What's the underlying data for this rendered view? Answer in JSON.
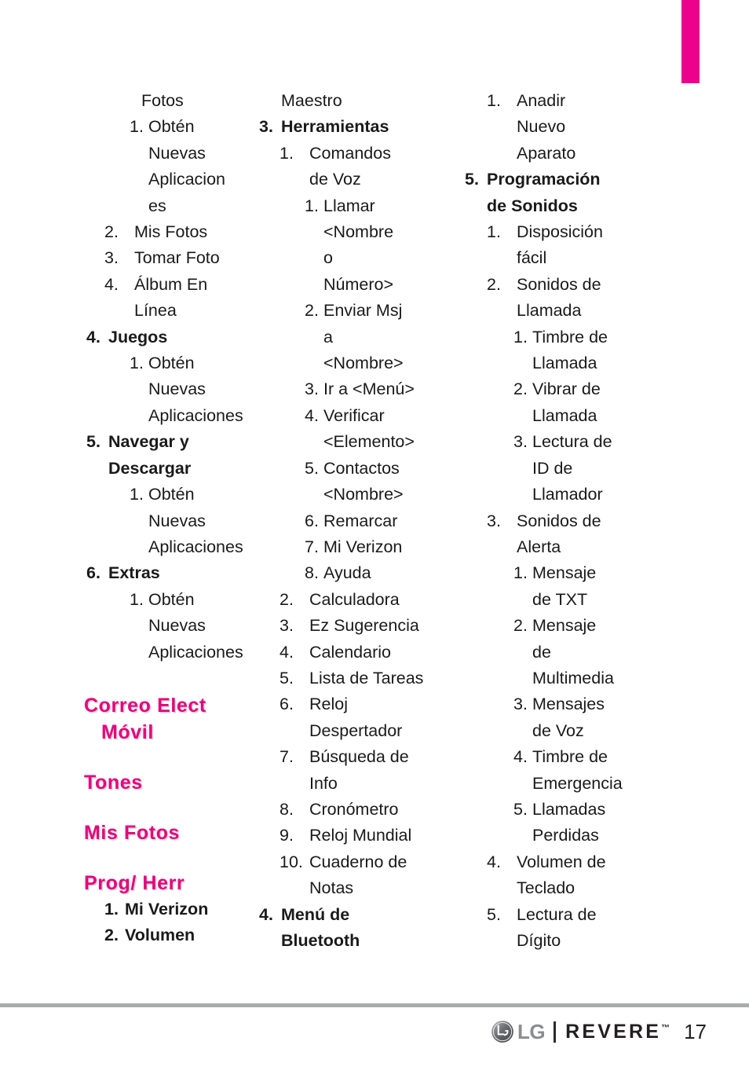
{
  "page": {
    "number": "17",
    "tab_color": "#ec008c",
    "heading_color": "#e6007e"
  },
  "footer": {
    "brand": "LG",
    "model": "REVERE",
    "trademark": "™",
    "page_number": "17"
  },
  "columns": [
    {
      "id": "column-1",
      "lines": [
        {
          "level": "plain",
          "num": "",
          "text": "Fotos"
        },
        {
          "level": "lvl3",
          "num": "1.",
          "text": "Obtén"
        },
        {
          "level": "cont-l3",
          "num": "",
          "text": "Nuevas"
        },
        {
          "level": "cont-l3",
          "num": "",
          "text": "Aplicacion"
        },
        {
          "level": "cont-l3",
          "num": "",
          "text": "es"
        },
        {
          "level": "lvl2",
          "num": "2.",
          "text": "Mis Fotos"
        },
        {
          "level": "lvl2",
          "num": "3.",
          "text": "Tomar Foto"
        },
        {
          "level": "lvl2",
          "num": "4.",
          "text": "Álbum En"
        },
        {
          "level": "cont-l2",
          "num": "",
          "text": "Línea"
        },
        {
          "level": "lvl1",
          "num": "4.",
          "text": "Juegos"
        },
        {
          "level": "lvl3",
          "num": "1.",
          "text": "Obtén"
        },
        {
          "level": "cont-l3",
          "num": "",
          "text": "Nuevas"
        },
        {
          "level": "cont-l3",
          "num": "",
          "text": "Aplicaciones"
        },
        {
          "level": "lvl1",
          "num": "5.",
          "text": "Navegar y"
        },
        {
          "level": "cont-l1",
          "num": "",
          "text": "Descargar"
        },
        {
          "level": "lvl3",
          "num": "1.",
          "text": "Obtén"
        },
        {
          "level": "cont-l3",
          "num": "",
          "text": "Nuevas"
        },
        {
          "level": "cont-l3",
          "num": "",
          "text": "Aplicaciones"
        },
        {
          "level": "lvl1",
          "num": "6.",
          "text": "Extras"
        },
        {
          "level": "lvl3",
          "num": "1.",
          "text": "Obtén"
        },
        {
          "level": "cont-l3",
          "num": "",
          "text": "Nuevas"
        },
        {
          "level": "cont-l3",
          "num": "",
          "text": "Aplicaciones"
        }
      ],
      "sections": [
        {
          "id": "correo-elect-movil",
          "title": "Correo Elect",
          "subtitle": "Móvil",
          "items": []
        },
        {
          "id": "tones",
          "title": "Tones",
          "subtitle": "",
          "items": []
        },
        {
          "id": "mis-fotos",
          "title": "Mis Fotos",
          "subtitle": "",
          "items": []
        },
        {
          "id": "prog-herr",
          "title": "Prog/ Herr",
          "subtitle": "",
          "items": [
            {
              "level": "lvl3-bold",
              "num": "1.",
              "text": "Mi Verizon"
            },
            {
              "level": "lvl3-bold",
              "num": "2.",
              "text": "Volumen"
            }
          ]
        }
      ]
    },
    {
      "id": "column-2",
      "lines": [
        {
          "level": "plain",
          "num": "",
          "text": "Maestro"
        },
        {
          "level": "lvl1",
          "num": "3.",
          "text": "Herramientas"
        },
        {
          "level": "lvl2",
          "num": "1.",
          "text": "Comandos"
        },
        {
          "level": "cont-l2",
          "num": "",
          "text": "de Voz"
        },
        {
          "level": "lvl3",
          "num": "1.",
          "text": "Llamar"
        },
        {
          "level": "cont-l3",
          "num": "",
          "text": "<Nombre"
        },
        {
          "level": "cont-l3",
          "num": "",
          "text": "o"
        },
        {
          "level": "cont-l3",
          "num": "",
          "text": "Número>"
        },
        {
          "level": "lvl3",
          "num": "2.",
          "text": "Enviar Msj"
        },
        {
          "level": "cont-l3",
          "num": "",
          "text": "a"
        },
        {
          "level": "cont-l3",
          "num": "",
          "text": "<Nombre>"
        },
        {
          "level": "lvl3",
          "num": "3.",
          "text": "Ir a <Menú>"
        },
        {
          "level": "lvl3",
          "num": "4.",
          "text": "Verificar"
        },
        {
          "level": "cont-l3",
          "num": "",
          "text": "<Elemento>"
        },
        {
          "level": "lvl3",
          "num": "5.",
          "text": "Contactos"
        },
        {
          "level": "cont-l3",
          "num": "",
          "text": "<Nombre>"
        },
        {
          "level": "lvl3",
          "num": "6.",
          "text": "Remarcar"
        },
        {
          "level": "lvl3",
          "num": "7.",
          "text": "Mi Verizon"
        },
        {
          "level": "lvl3",
          "num": "8.",
          "text": "Ayuda"
        },
        {
          "level": "lvl2",
          "num": "2.",
          "text": "Calculadora"
        },
        {
          "level": "lvl2",
          "num": "3.",
          "text": "Ez Sugerencia"
        },
        {
          "level": "lvl2",
          "num": "4.",
          "text": "Calendario"
        },
        {
          "level": "lvl2",
          "num": "5.",
          "text": "Lista de Tareas"
        },
        {
          "level": "lvl2",
          "num": "6.",
          "text": "Reloj"
        },
        {
          "level": "cont-l2",
          "num": "",
          "text": "Despertador"
        },
        {
          "level": "lvl2",
          "num": "7.",
          "text": "Búsqueda de"
        },
        {
          "level": "cont-l2",
          "num": "",
          "text": "Info"
        },
        {
          "level": "lvl2",
          "num": "8.",
          "text": "Cronómetro"
        },
        {
          "level": "lvl2",
          "num": "9.",
          "text": "Reloj Mundial"
        },
        {
          "level": "lvl2",
          "num": "10.",
          "text": "Cuaderno de"
        },
        {
          "level": "cont-l2",
          "num": "",
          "text": "Notas"
        },
        {
          "level": "lvl1",
          "num": "4.",
          "text": "Menú de"
        },
        {
          "level": "cont-l1",
          "num": "",
          "text": "Bluetooth"
        }
      ],
      "sections": []
    },
    {
      "id": "column-3",
      "lines": [
        {
          "level": "lvl2",
          "num": "1.",
          "text": "Anadir"
        },
        {
          "level": "cont-l2",
          "num": "",
          "text": "Nuevo"
        },
        {
          "level": "cont-l2",
          "num": "",
          "text": "Aparato"
        },
        {
          "level": "lvl1",
          "num": "5.",
          "text": "Programación"
        },
        {
          "level": "cont-l1",
          "num": "",
          "text": "de Sonidos"
        },
        {
          "level": "lvl2",
          "num": "1.",
          "text": "Disposición"
        },
        {
          "level": "cont-l2",
          "num": "",
          "text": "fácil"
        },
        {
          "level": "lvl2",
          "num": "2.",
          "text": "Sonidos de"
        },
        {
          "level": "cont-l2",
          "num": "",
          "text": "Llamada"
        },
        {
          "level": "lvl3",
          "num": "1.",
          "text": "Timbre de"
        },
        {
          "level": "cont-l3",
          "num": "",
          "text": "Llamada"
        },
        {
          "level": "lvl3",
          "num": "2.",
          "text": "Vibrar de"
        },
        {
          "level": "cont-l3",
          "num": "",
          "text": "Llamada"
        },
        {
          "level": "lvl3",
          "num": "3.",
          "text": "Lectura de"
        },
        {
          "level": "cont-l3",
          "num": "",
          "text": "ID de"
        },
        {
          "level": "cont-l3",
          "num": "",
          "text": "Llamador"
        },
        {
          "level": "lvl2",
          "num": "3.",
          "text": "Sonidos de"
        },
        {
          "level": "cont-l2",
          "num": "",
          "text": "Alerta"
        },
        {
          "level": "lvl3",
          "num": "1.",
          "text": "Mensaje"
        },
        {
          "level": "cont-l3",
          "num": "",
          "text": "de TXT"
        },
        {
          "level": "lvl3",
          "num": "2.",
          "text": "Mensaje"
        },
        {
          "level": "cont-l3",
          "num": "",
          "text": "de"
        },
        {
          "level": "cont-l3",
          "num": "",
          "text": "Multimedia"
        },
        {
          "level": "lvl3",
          "num": "3.",
          "text": "Mensajes"
        },
        {
          "level": "cont-l3",
          "num": "",
          "text": "de Voz"
        },
        {
          "level": "lvl3",
          "num": "4.",
          "text": "Timbre de"
        },
        {
          "level": "cont-l3",
          "num": "",
          "text": "Emergencia"
        },
        {
          "level": "lvl3",
          "num": "5.",
          "text": "Llamadas"
        },
        {
          "level": "cont-l3",
          "num": "",
          "text": "Perdidas"
        },
        {
          "level": "lvl2",
          "num": "4.",
          "text": "Volumen de"
        },
        {
          "level": "cont-l2",
          "num": "",
          "text": "Teclado"
        },
        {
          "level": "lvl2",
          "num": "5.",
          "text": "Lectura de"
        },
        {
          "level": "cont-l2",
          "num": "",
          "text": "Dígito"
        }
      ],
      "sections": []
    }
  ]
}
